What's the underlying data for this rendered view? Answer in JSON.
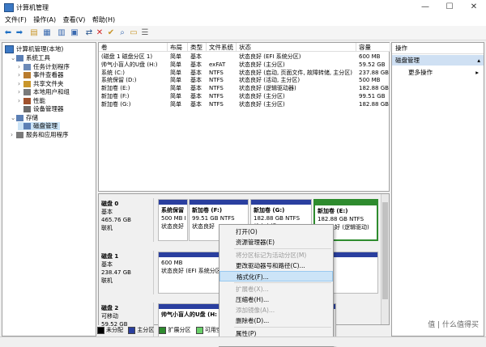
{
  "window": {
    "title": "计算机管理",
    "minimize": "—",
    "maximize": "☐",
    "close": "✕"
  },
  "menu": [
    "文件(F)",
    "操作(A)",
    "查看(V)",
    "帮助(H)"
  ],
  "tree": {
    "root": "计算机管理(本地)",
    "items": [
      {
        "label": "系统工具",
        "depth": 1,
        "expander": "⌄"
      },
      {
        "label": "任务计划程序",
        "depth": 2,
        "expander": "›"
      },
      {
        "label": "事件查看器",
        "depth": 2,
        "expander": "›"
      },
      {
        "label": "共享文件夹",
        "depth": 2,
        "expander": "›"
      },
      {
        "label": "本地用户和组",
        "depth": 2,
        "expander": "›"
      },
      {
        "label": "性能",
        "depth": 2,
        "expander": "›"
      },
      {
        "label": "设备管理器",
        "depth": 2,
        "expander": ""
      },
      {
        "label": "存储",
        "depth": 1,
        "expander": "⌄"
      },
      {
        "label": "磁盘管理",
        "depth": 2,
        "expander": ""
      },
      {
        "label": "服务和应用程序",
        "depth": 1,
        "expander": "›"
      }
    ]
  },
  "volumes": {
    "headers": [
      "卷",
      "布局",
      "类型",
      "文件系统",
      "状态",
      "容量"
    ],
    "rows": [
      [
        "(磁盘 1 磁盘分区 1)",
        "简单",
        "基本",
        "",
        "状态良好 (EFI 系统分区)",
        "600 MB"
      ],
      [
        "帅气小盲人的U盘 (H:)",
        "简单",
        "基本",
        "exFAT",
        "状态良好 (主分区)",
        "59.52 GB"
      ],
      [
        "系统 (C:)",
        "简单",
        "基本",
        "NTFS",
        "状态良好 (启动, 页面文件, 故障转储, 主分区)",
        "237.88 GB"
      ],
      [
        "系统保留 (D:)",
        "简单",
        "基本",
        "NTFS",
        "状态良好 (活动, 主分区)",
        "500 MB"
      ],
      [
        "新加卷 (E:)",
        "简单",
        "基本",
        "NTFS",
        "状态良好 (逻辑驱动器)",
        "182.88 GB"
      ],
      [
        "新加卷 (F:)",
        "简单",
        "基本",
        "NTFS",
        "状态良好 (主分区)",
        "99.51 GB"
      ],
      [
        "新加卷 (G:)",
        "简单",
        "基本",
        "NTFS",
        "状态良好 (主分区)",
        "182.88 GB"
      ]
    ]
  },
  "disks": [
    {
      "name": "磁盘 0",
      "lines": [
        "基本",
        "465.76 GB",
        "联机"
      ],
      "parts": [
        {
          "l1": "系统保留",
          "l2": "500 MB N",
          "l3": "状态良好"
        },
        {
          "l1": "新加卷 (F:)",
          "l2": "99.51 GB NTFS",
          "l3": "状态良好"
        },
        {
          "l1": "新加卷 (G:)",
          "l2": "182.88 GB NTFS",
          "l3": "状态良好"
        },
        {
          "l1": "新加卷 (E:)",
          "l2": "182.88 GB NTFS",
          "l3": "状态良好 (逻辑驱动)"
        }
      ]
    },
    {
      "name": "磁盘 1",
      "lines": [
        "基本",
        "238.47 GB",
        "联机"
      ],
      "parts": [
        {
          "l1": "",
          "l2": "600 MB",
          "l3": "状态良好 (EFI 系统分区)"
        },
        {
          "l1": "",
          "l2": "",
          "l3": "主分区)"
        }
      ]
    },
    {
      "name": "磁盘 2",
      "lines": [
        "可移动",
        "59.52 GB"
      ],
      "parts": [
        {
          "l1": "帅气小盲人的U盘 (H:",
          "l2": "",
          "l3": ""
        }
      ]
    }
  ],
  "legend": [
    "未分配",
    "主分区",
    "扩展分区",
    "可用空间"
  ],
  "legend_colors": [
    "#000000",
    "#2a3f9f",
    "#2e8b2e",
    "#6ad16a"
  ],
  "actions": {
    "header": "操作",
    "section": "磁盘管理",
    "more": "更多操作",
    "more_arrow": "▸"
  },
  "context_menu": {
    "items": [
      {
        "label": "打开(O)",
        "disabled": false
      },
      {
        "label": "资源管理器(E)",
        "disabled": false
      },
      {
        "label": "将分区标记为活动分区(M)",
        "disabled": true
      },
      {
        "label": "更改驱动器号和路径(C)...",
        "disabled": false
      },
      {
        "label": "格式化(F)...",
        "disabled": false,
        "highlight": true
      },
      {
        "label": "扩展卷(X)...",
        "disabled": true
      },
      {
        "label": "压缩卷(H)...",
        "disabled": false
      },
      {
        "label": "添加镜像(A)...",
        "disabled": true
      },
      {
        "label": "删除卷(D)...",
        "disabled": false
      },
      {
        "label": "属性(P)",
        "disabled": false
      }
    ]
  },
  "watermark": "值 | 什么值得买"
}
